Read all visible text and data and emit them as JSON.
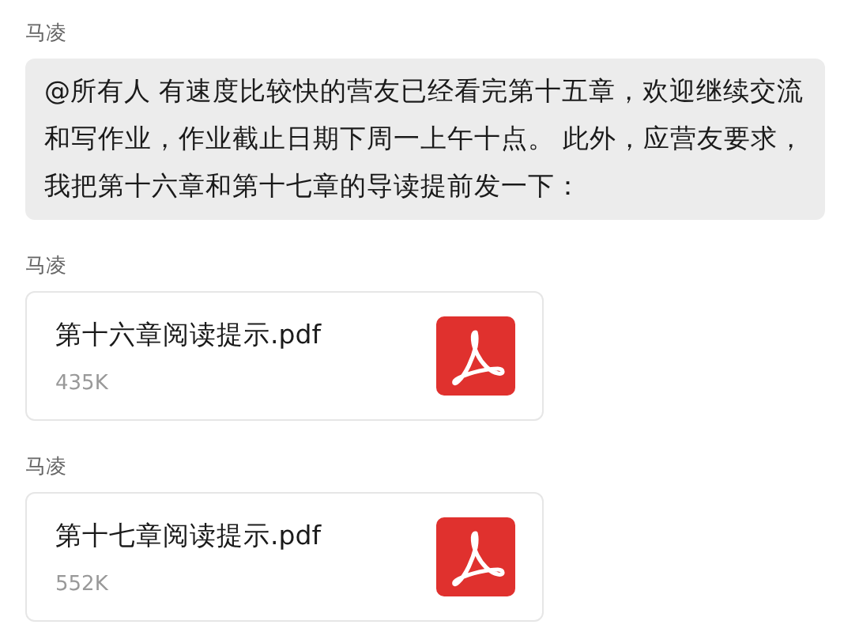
{
  "messages": [
    {
      "kind": "text",
      "sender": "马凌",
      "text": "@所有人  有速度比较快的营友已经看完第十五章，欢迎继续交流和写作业，作业截止日期下周一上午十点。 此外，应营友要求，我把第十六章和第十七章的导读提前发一下："
    },
    {
      "kind": "file",
      "sender": "马凌",
      "filename": "第十六章阅读提示.pdf",
      "size": "435K"
    },
    {
      "kind": "file",
      "sender": "马凌",
      "filename": "第十七章阅读提示.pdf",
      "size": "552K"
    }
  ]
}
